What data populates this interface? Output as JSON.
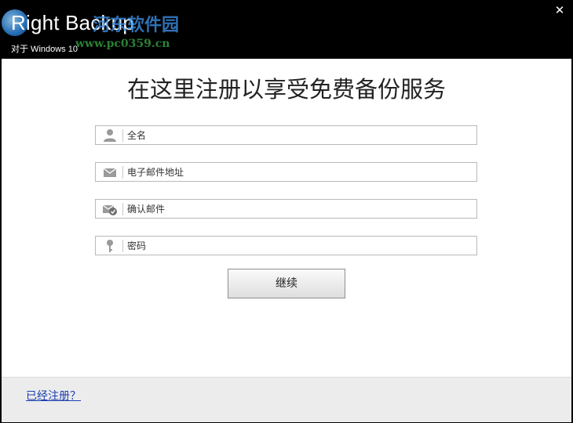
{
  "window": {
    "title": "Right Backup",
    "subtitle": "对于 Windows 10",
    "close_glyph": "✕"
  },
  "watermark": {
    "text": "河东软件园",
    "url": "www.pc0359.cn"
  },
  "form": {
    "heading": "在这里注册以享受免费备份服务",
    "fields": [
      {
        "icon": "person-icon",
        "placeholder": "全名"
      },
      {
        "icon": "mail-icon",
        "placeholder": "电子邮件地址"
      },
      {
        "icon": "mail-check-icon",
        "placeholder": "确认邮件"
      },
      {
        "icon": "key-icon",
        "placeholder": "密码"
      }
    ],
    "continue_label": "继续"
  },
  "footer": {
    "link_label": "已经注册？"
  },
  "colors": {
    "titlebar": "#000000",
    "link": "#1a3fb0",
    "footer_bg": "#ececec"
  }
}
